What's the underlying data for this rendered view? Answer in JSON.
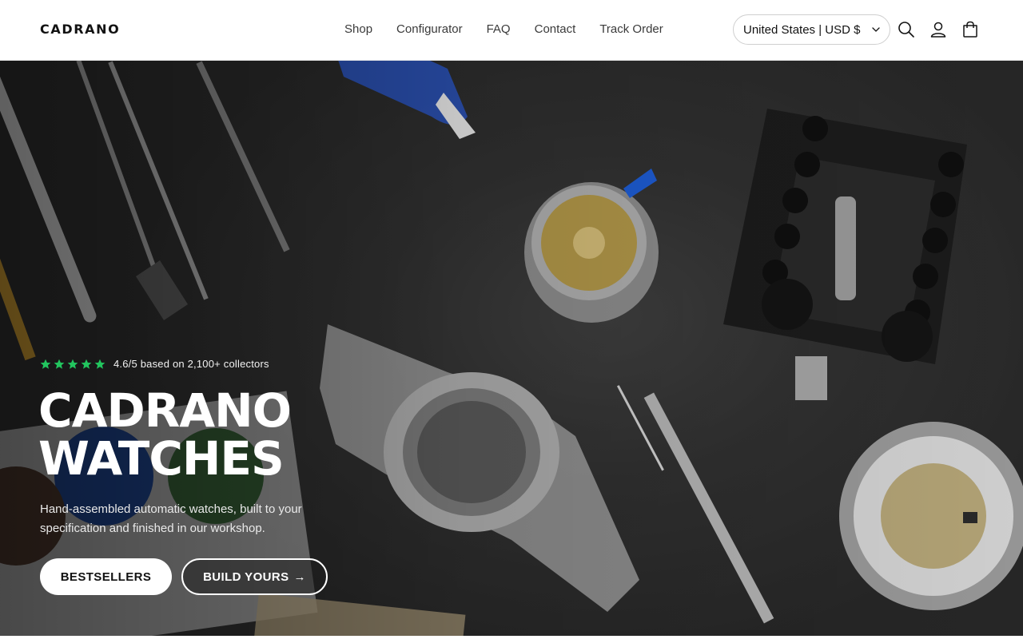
{
  "header": {
    "logo": "CADRANO",
    "nav": [
      "Shop",
      "Configurator",
      "FAQ",
      "Contact",
      "Track Order"
    ],
    "locale": "United States | USD $",
    "icons": [
      "search-icon",
      "account-icon",
      "cart-icon"
    ]
  },
  "hero": {
    "rating": {
      "stars": 5,
      "text": "4.6/5 based on 2,100+ collectors",
      "star_color": "#22c55e"
    },
    "title_line1": "CADRANO",
    "title_line2": "WATCHES",
    "subtitle": "Hand-assembled automatic watches, built to your specification and finished in our workshop.",
    "primary_button": "BESTSELLERS",
    "secondary_button": "BUILD YOURS",
    "secondary_button_arrow": "→"
  }
}
